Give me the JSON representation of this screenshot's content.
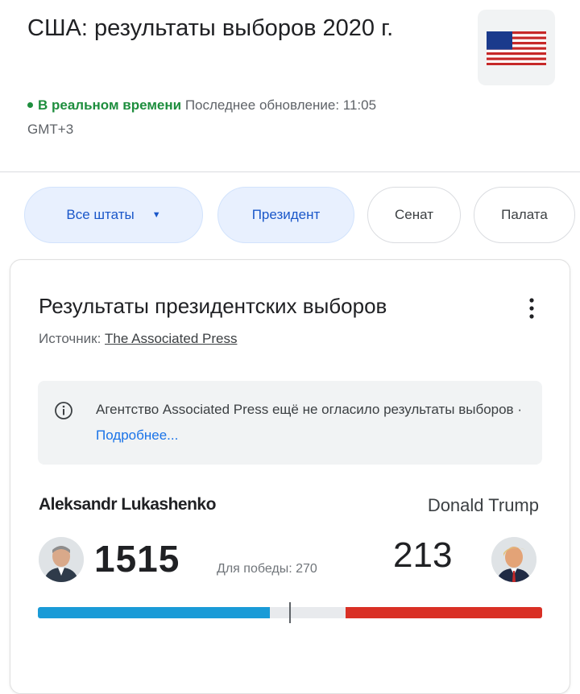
{
  "header": {
    "title": "США: результаты выборов 2020 г.",
    "live_label": "В реальном времени",
    "updated_text": "Последнее обновление: 11:05 GMT+3"
  },
  "filters": {
    "states_label": "Все штаты",
    "president_label": "Президент",
    "senate_label": "Сенат",
    "house_label": "Палата"
  },
  "card": {
    "title": "Результаты президентских выборов",
    "source_prefix": "Источник: ",
    "source_link": "The Associated Press",
    "notice_text": "Агентство Associated Press ещё не огласило результаты выборов · ",
    "notice_link": "Подробнее..."
  },
  "candidates": {
    "left": {
      "name": "Aleksandr Lukashenko",
      "votes": "1515",
      "color": "#1a9bd7"
    },
    "right": {
      "name": "Donald Trump",
      "votes": "213",
      "color": "#d93025"
    },
    "to_win_label": "Для победы: 270"
  },
  "progress": {
    "left_fraction": 0.46,
    "right_fraction": 0.39
  },
  "colors": {
    "accent": "#1a73e8",
    "live": "#1e8e3e",
    "chip_active_bg": "#e8f0fe"
  }
}
